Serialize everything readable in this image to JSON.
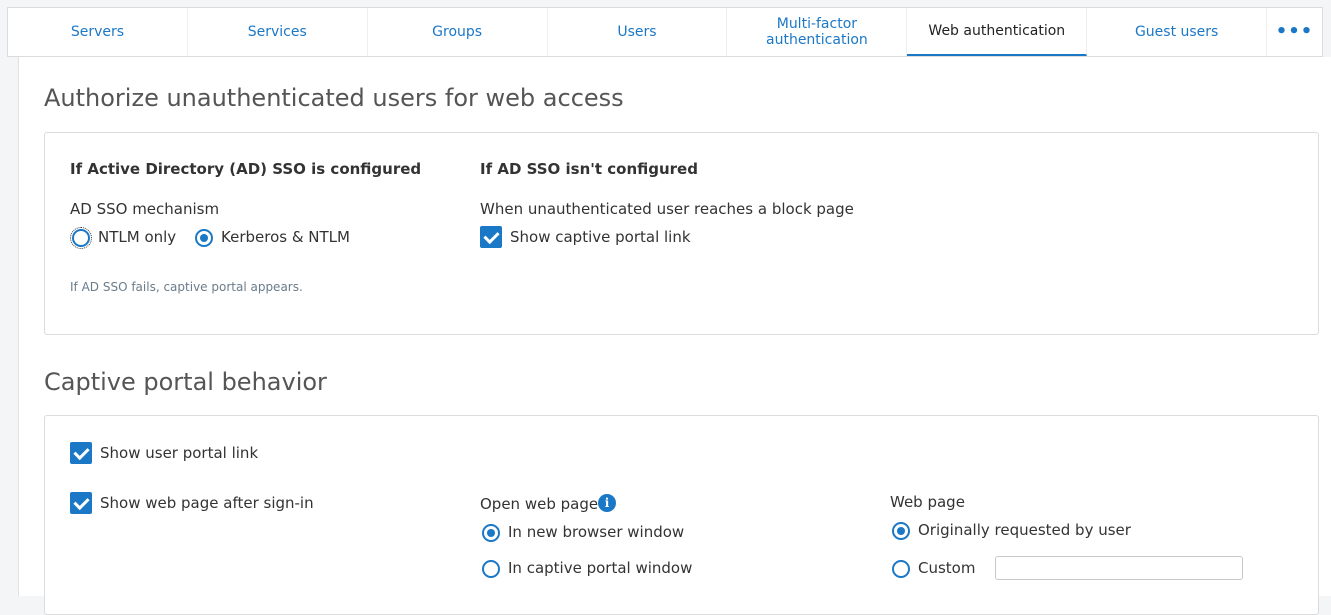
{
  "tabs": [
    {
      "label": "Servers"
    },
    {
      "label": "Services"
    },
    {
      "label": "Groups"
    },
    {
      "label": "Users"
    },
    {
      "label": "Multi-factor authentication"
    },
    {
      "label": "Web authentication"
    },
    {
      "label": "Guest users"
    },
    {
      "label": "•••"
    }
  ],
  "active_tab": "Web authentication",
  "section1": {
    "title": "Authorize unauthenticated users for web access",
    "left_heading": "If Active Directory (AD) SSO is configured",
    "mechanism_label": "AD SSO mechanism",
    "radio_ntlm": "NTLM only",
    "radio_kerberos": "Kerberos & NTLM",
    "hint": "If AD SSO fails, captive portal appears.",
    "right_heading": "If AD SSO isn't configured",
    "block_page_label": "When unauthenticated user reaches a block page",
    "show_captive_link": "Show captive portal link"
  },
  "section2": {
    "title": "Captive portal behavior",
    "show_user_portal": "Show user portal link",
    "show_web_page": "Show web page after sign-in",
    "open_web_page_label": "Open web page",
    "radio_new_window": "In new browser window",
    "radio_captive_window": "In captive portal window",
    "web_page_label": "Web page",
    "radio_originally": "Originally requested by user",
    "radio_custom": "Custom",
    "custom_value": ""
  },
  "colors": {
    "accent": "#1b78c6"
  },
  "icons": {
    "info": "info-icon",
    "more": "more-icon"
  }
}
